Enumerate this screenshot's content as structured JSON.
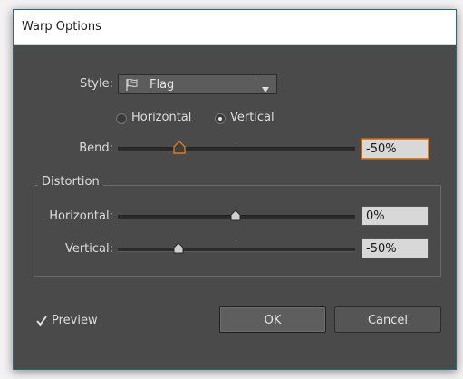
{
  "window": {
    "title": "Warp Options"
  },
  "style": {
    "label": "Style:",
    "selected": "Flag",
    "icon": "flag-icon"
  },
  "orientation": {
    "options": [
      "Horizontal",
      "Vertical"
    ],
    "selected": "Vertical"
  },
  "bend": {
    "label": "Bend:",
    "value": "-50%",
    "level": -50
  },
  "distortion": {
    "title": "Distortion",
    "horizontal": {
      "label": "Horizontal:",
      "value": "0%",
      "level": 0
    },
    "vertical": {
      "label": "Vertical:",
      "value": "-50%",
      "level": -50
    }
  },
  "preview": {
    "label": "Preview",
    "checked": true
  },
  "buttons": {
    "ok": "OK",
    "cancel": "Cancel"
  },
  "colors": {
    "accent": "#e07b1f",
    "panel": "#4a4a4a",
    "field": "#d8d8d8"
  }
}
